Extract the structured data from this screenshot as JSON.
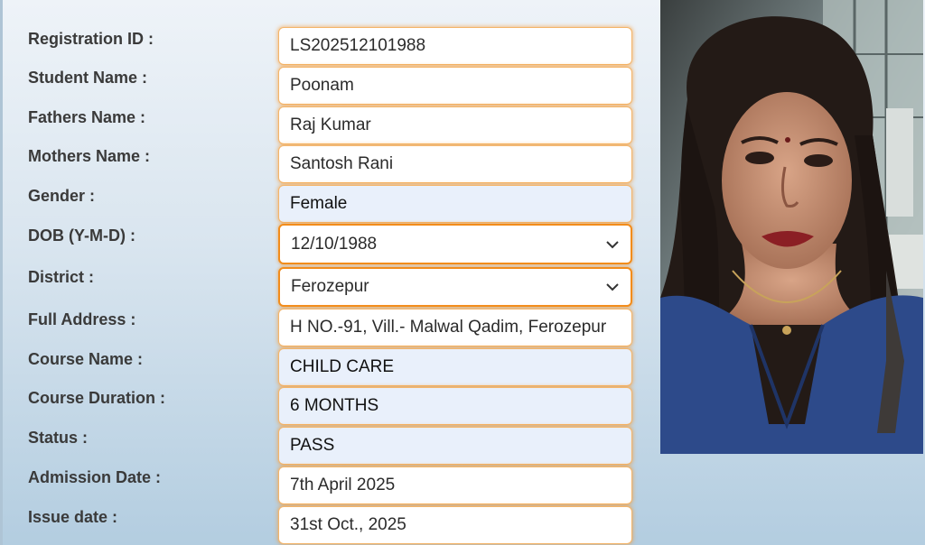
{
  "form": {
    "rows": [
      {
        "label": "Registration ID :",
        "value": "LS202512101988"
      },
      {
        "label": "Student Name :",
        "value": "Poonam"
      },
      {
        "label": "Fathers Name :",
        "value": "Raj Kumar"
      },
      {
        "label": "Mothers Name :",
        "value": "Santosh Rani"
      },
      {
        "label": "Gender :",
        "value": "Female"
      },
      {
        "label": "DOB (Y-M-D) :",
        "value": "12/10/1988"
      },
      {
        "label": "District :",
        "value": "Ferozepur"
      },
      {
        "label": "Full Address :",
        "value": "H NO.-91, Vill.- Malwal Qadim, Ferozepur"
      },
      {
        "label": "Course Name :",
        "value": "CHILD CARE"
      },
      {
        "label": "Course Duration :",
        "value": "6 MONTHS"
      },
      {
        "label": "Status :",
        "value": "PASS"
      },
      {
        "label": "Admission Date :",
        "value": "7th April 2025"
      },
      {
        "label": "Issue date :",
        "value": "31st Oct., 2025"
      }
    ]
  },
  "icons": {
    "dropdown": "chevron-down-icon"
  },
  "colors": {
    "accent": "#f28c1b",
    "field_tint": "#e9f0fb",
    "label": "#3a3a3a"
  }
}
